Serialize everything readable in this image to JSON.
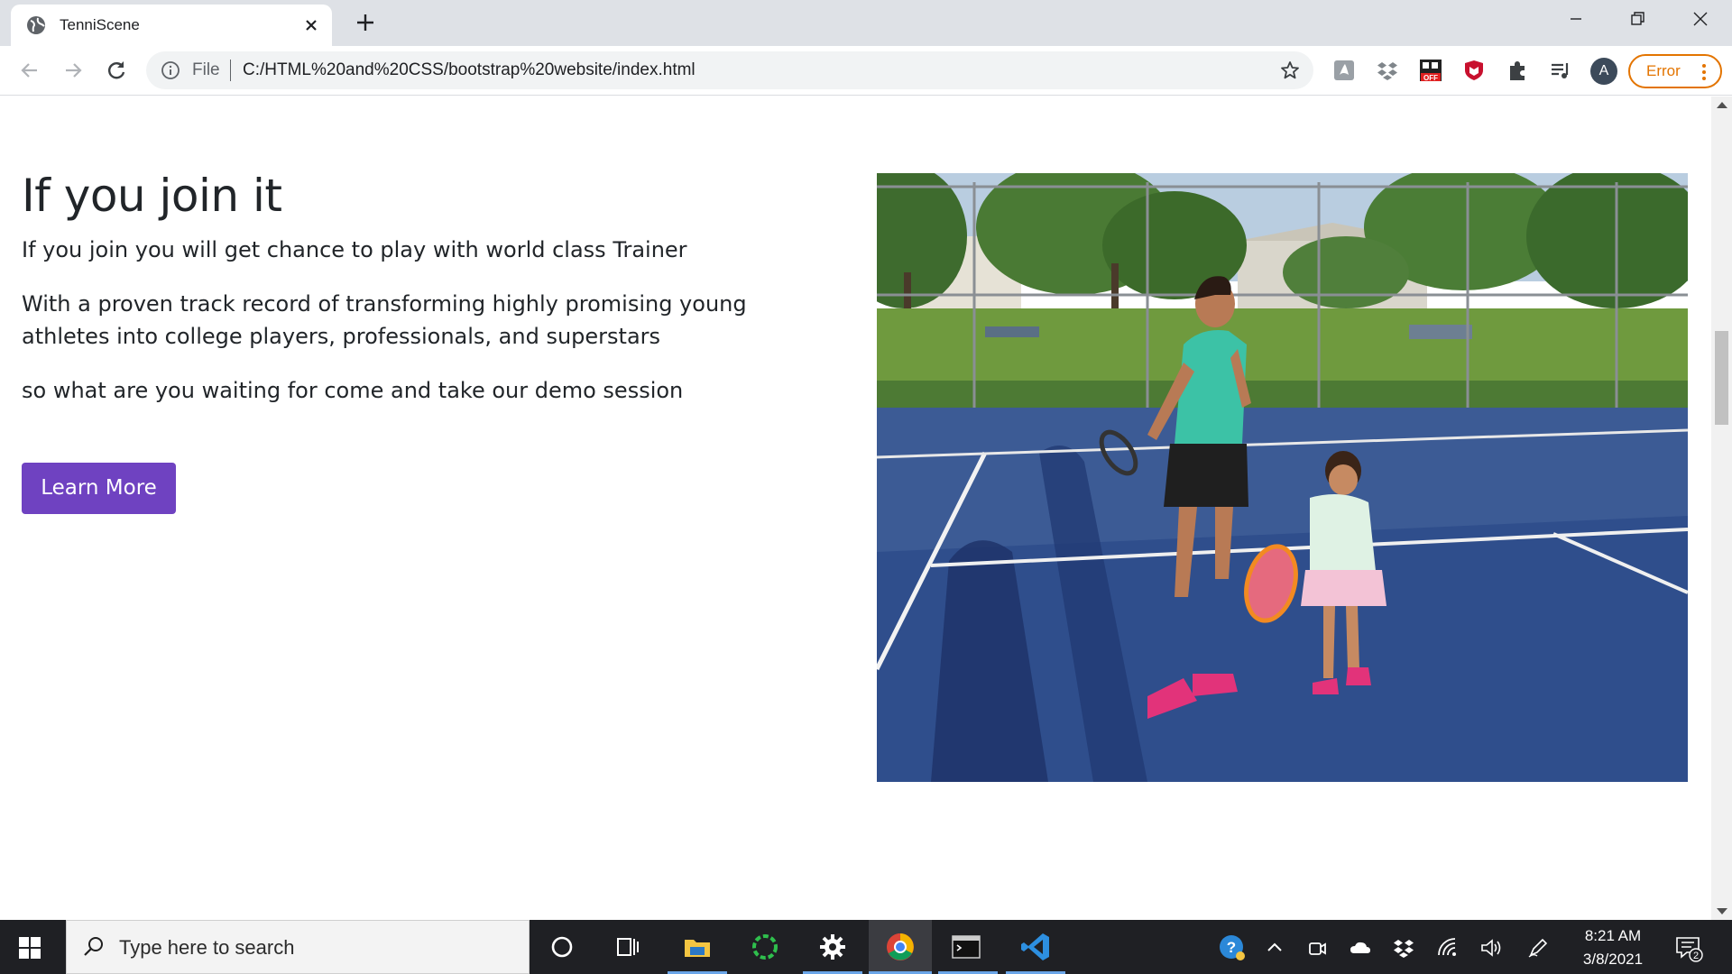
{
  "browser": {
    "tab_title": "TenniScene",
    "omnibox_scheme_label": "File",
    "url": "C:/HTML%20and%20CSS/bootstrap%20website/index.html",
    "profile_initial": "A",
    "error_label": "Error",
    "extension_icons": [
      "pdf-extension-icon",
      "dropbox-extension-icon",
      "coupon-extension-icon",
      "mcafee-extension-icon",
      "puzzle-extensions-icon",
      "media-control-icon"
    ]
  },
  "page": {
    "headline": "If you join it",
    "paragraphs": [
      "If you join you will get chance to play with world class Trainer",
      "With a proven track record of transforming highly promising young athletes into college players, professionals, and superstars",
      "so what are you waiting for come and take our demo session"
    ],
    "cta_label": "Learn More",
    "accent_color": "#6f42c1"
  },
  "taskbar": {
    "search_placeholder": "Type here to search",
    "time": "8:21 AM",
    "date": "3/8/2021",
    "notification_count": "2",
    "apps": [
      "cortana-icon",
      "task-view-icon",
      "file-explorer-icon",
      "spinner-app-icon",
      "settings-gear-icon",
      "chrome-icon",
      "terminal-icon",
      "vscode-icon"
    ]
  }
}
